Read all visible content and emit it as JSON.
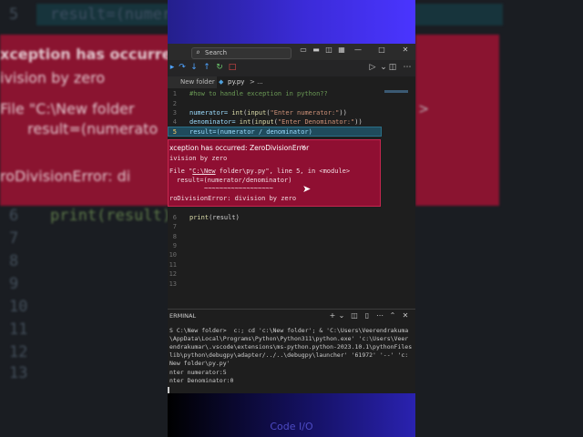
{
  "background": {
    "left_num": "5",
    "left_code": "result=(numerat",
    "err_lines": [
      "xception has occurred:",
      "ivision by zero",
      "File \"C:\\New folder",
      "  result=(numerato",
      "roDivisionError: di"
    ],
    "gutter_nums": [
      "6",
      "7",
      "8",
      "9",
      "10",
      "11",
      "12",
      "13"
    ],
    "print_line": "print(result)",
    "right_arrow": ">"
  },
  "window": {
    "search_placeholder": "Search",
    "controls": {
      "minimize": "—",
      "maximize": "□",
      "close": "✕"
    }
  },
  "tabs": [
    {
      "label": "New folder"
    },
    {
      "label": "py.py",
      "breadcrumb": "> ..."
    }
  ],
  "editor": {
    "line_numbers": [
      "1",
      "2",
      "3",
      "4",
      "5",
      "6",
      "7",
      "8",
      "9",
      "10",
      "11",
      "12",
      "13"
    ],
    "lines": {
      "l1": "#how to handle exception in python??",
      "l3_a": "numerator= ",
      "l3_fn": "int",
      "l3_b": "(",
      "l3_fn2": "input",
      "l3_c": "(",
      "l3_str": "\"Enter numerator:\"",
      "l3_d": "))",
      "l4_a": "denominator= ",
      "l4_fn": "int",
      "l4_b": "(",
      "l4_fn2": "input",
      "l4_c": "(",
      "l4_str": "\"Enter Denominator:\"",
      "l4_d": "))",
      "l5": "result=(numerator / denominator)",
      "l6_fn": "print",
      "l6_rest": "(result)"
    }
  },
  "exception": {
    "title": "xception has occurred: ZeroDivisionError",
    "close": "✕",
    "message": "ivision by zero",
    "trace1_a": "File \"",
    "trace1_link": "C:\\New",
    "trace1_b": " folder\\py.py\", line 5, in <module>",
    "trace2": "result=(numerator/denominator)",
    "trace3": "~~~~~~~~~~~~~~~~~~",
    "final": "roDivisionError: division by zero"
  },
  "terminal": {
    "title": "ERMINAL",
    "lines": [
      "S C:\\New folder>  c:; cd 'c:\\New folder'; & 'C:\\Users\\Veerendrakuma",
      "\\AppData\\Local\\Programs\\Python\\Python311\\python.exe' 'c:\\Users\\Veer",
      "endrakumar\\.vscode\\extensions\\ms-python.python-2023.10.1\\pythonFiles",
      "lib\\python\\debugpy\\adapter/../..\\debugpy\\launcher' '61972' '--' 'c:",
      "New folder\\py.py'",
      "nter numerator:5",
      "nter Denominator:0"
    ]
  },
  "brand": "Code I/O",
  "colors": {
    "error_bg": "#8f0f32",
    "accent": "#3b2bd8",
    "highlight": "#1f4b5c"
  }
}
